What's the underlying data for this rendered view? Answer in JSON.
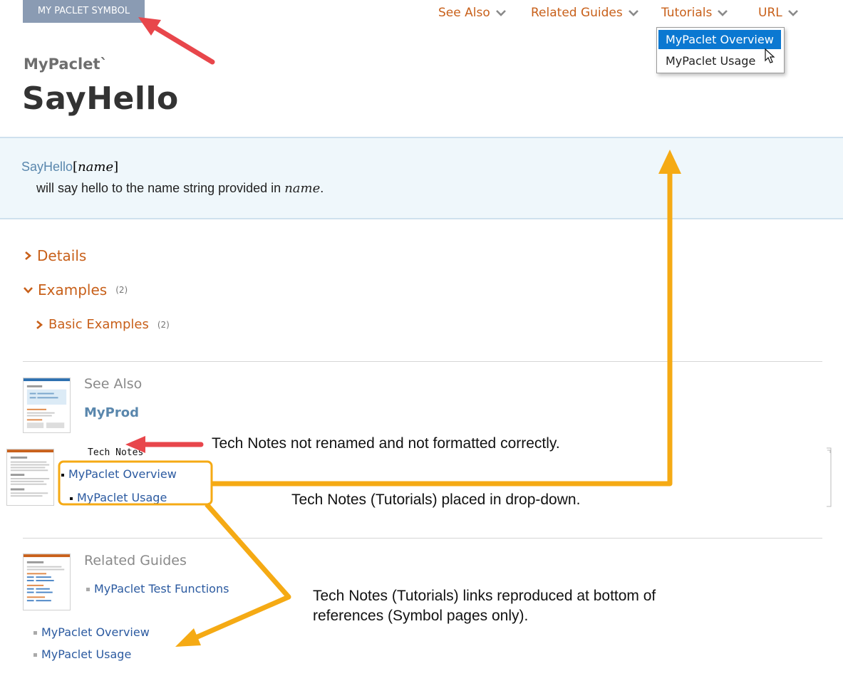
{
  "header": {
    "symbol_tag": "MY PACLET SYMBOL",
    "nav": [
      {
        "label": "See Also"
      },
      {
        "label": "Related Guides"
      },
      {
        "label": "Tutorials"
      },
      {
        "label": "URL"
      }
    ],
    "tutorials_dropdown": {
      "items": [
        "MyPaclet Overview",
        "MyPaclet Usage"
      ],
      "selected": "MyPaclet Overview"
    }
  },
  "page": {
    "context": "MyPaclet`",
    "title": "SayHello"
  },
  "usage": {
    "function": "SayHello",
    "open": "[",
    "arg": "name",
    "close": "]",
    "desc_prefix": "will say hello to the name string provided in ",
    "desc_arg": "name",
    "desc_suffix": "."
  },
  "sections": {
    "details": "Details",
    "examples": "Examples",
    "examples_count": "(2)",
    "basic_examples": "Basic Examples",
    "basic_examples_count": "(2)"
  },
  "see_also": {
    "heading": "See Also",
    "link": "MyProd"
  },
  "tech_notes": {
    "heading": "Tech Notes",
    "links": [
      "MyPaclet Overview",
      "MyPaclet Usage"
    ]
  },
  "related_guides": {
    "heading": "Related Guides",
    "links": [
      "MyPaclet Test Functions"
    ]
  },
  "bottom_links": [
    "MyPaclet Overview",
    "MyPaclet Usage"
  ],
  "annotations": {
    "tech_notes_issue": "Tech Notes not renamed and not formatted correctly.",
    "dropdown_note": "Tech Notes (Tutorials) placed in drop-down.",
    "bottom_note_line1": "Tech Notes (Tutorials) links reproduced at bottom of",
    "bottom_note_line2": "references (Symbol pages only)."
  },
  "colors": {
    "accent_orange": "#c8601a",
    "link_blue": "#2b5aa0",
    "selection_blue": "#0b78d1",
    "annotation_red": "#e8464b",
    "annotation_yellow": "#f5aa14"
  }
}
